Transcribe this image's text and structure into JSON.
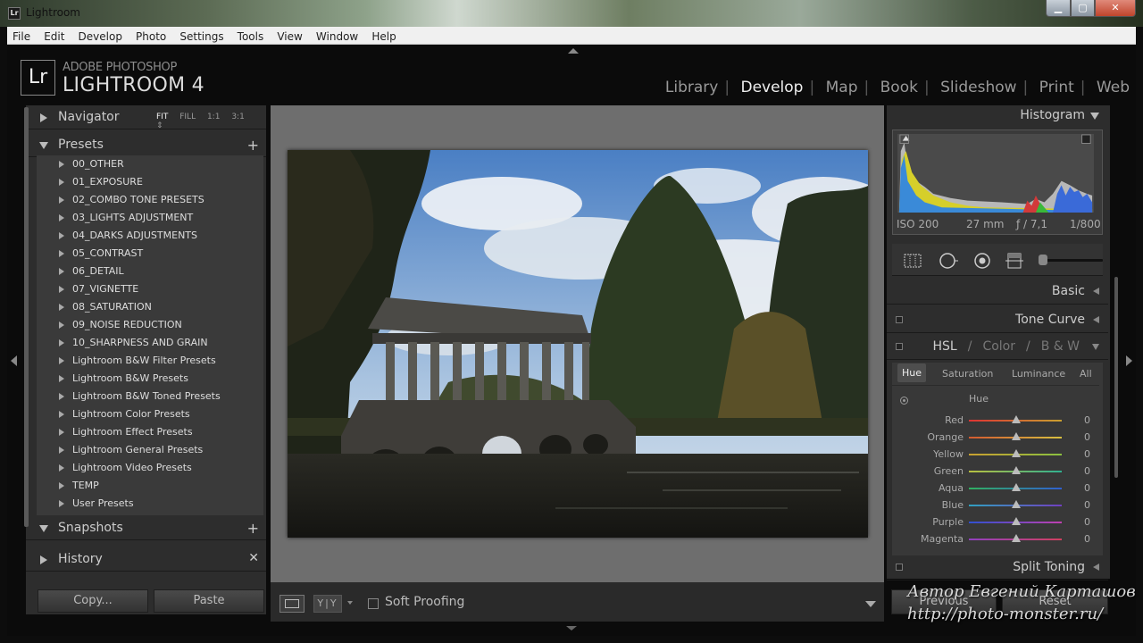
{
  "window": {
    "title": "Lightroom",
    "app_icon": "Lr"
  },
  "menu": [
    "File",
    "Edit",
    "Develop",
    "Photo",
    "Settings",
    "Tools",
    "View",
    "Window",
    "Help"
  ],
  "logo": {
    "mark": "Lr",
    "adobe": "ADOBE PHOTOSHOP",
    "product": "LIGHTROOM 4"
  },
  "modules": {
    "items": [
      "Library",
      "Develop",
      "Map",
      "Book",
      "Slideshow",
      "Print",
      "Web"
    ],
    "active": "Develop"
  },
  "navigator": {
    "title": "Navigator",
    "options": [
      "FIT",
      "FILL",
      "1:1",
      "3:1"
    ],
    "active": "FIT"
  },
  "presets": {
    "title": "Presets",
    "items": [
      "00_OTHER",
      "01_EXPOSURE",
      "02_COMBO TONE PRESETS",
      "03_LIGHTS ADJUSTMENT",
      "04_DARKS ADJUSTMENTS",
      "05_CONTRAST",
      "06_DETAIL",
      "07_VIGNETTE",
      "08_SATURATION",
      "09_NOISE REDUCTION",
      "10_SHARPNESS AND GRAIN",
      "Lightroom B&W Filter Presets",
      "Lightroom B&W Presets",
      "Lightroom B&W Toned Presets",
      "Lightroom Color Presets",
      "Lightroom Effect Presets",
      "Lightroom General Presets",
      "Lightroom Video Presets",
      "TEMP",
      "User Presets"
    ]
  },
  "snapshots": {
    "title": "Snapshots"
  },
  "history": {
    "title": "History"
  },
  "left_buttons": {
    "copy": "Copy...",
    "paste": "Paste"
  },
  "toolbar": {
    "yy": "Y|Y",
    "soft_proofing": "Soft Proofing"
  },
  "histogram": {
    "title": "Histogram",
    "iso": "ISO 200",
    "focal": "27 mm",
    "aperture": "ƒ / 7,1",
    "shutter": "1/800"
  },
  "panels": {
    "basic": "Basic",
    "tone_curve": "Tone Curve",
    "split_toning": "Split Toning"
  },
  "hsl": {
    "title_parts": [
      "HSL",
      "/",
      "Color",
      "/",
      "B & W"
    ],
    "tabs": [
      "Hue",
      "Saturation",
      "Luminance",
      "All"
    ],
    "active_tab": "Hue",
    "section": "Hue",
    "rows": [
      {
        "name": "Red",
        "value": "0",
        "c1": "#d33",
        "c2": "#c9a030"
      },
      {
        "name": "Orange",
        "value": "0",
        "c1": "#d35a30",
        "c2": "#d8c040"
      },
      {
        "name": "Yellow",
        "value": "0",
        "c1": "#c9a030",
        "c2": "#8bc040"
      },
      {
        "name": "Green",
        "value": "0",
        "c1": "#b8c040",
        "c2": "#30b090"
      },
      {
        "name": "Aqua",
        "value": "0",
        "c1": "#30b060",
        "c2": "#3060d0"
      },
      {
        "name": "Blue",
        "value": "0",
        "c1": "#30a0c0",
        "c2": "#7040c0"
      },
      {
        "name": "Purple",
        "value": "0",
        "c1": "#3050d0",
        "c2": "#c040b0"
      },
      {
        "name": "Magenta",
        "value": "0",
        "c1": "#9040c0",
        "c2": "#d04060"
      }
    ]
  },
  "right_buttons": {
    "previous": "Previous",
    "reset": "Reset"
  },
  "watermark": {
    "line1": "Автор Евгений Карташов",
    "line2": "http://photo-monster.ru/"
  }
}
